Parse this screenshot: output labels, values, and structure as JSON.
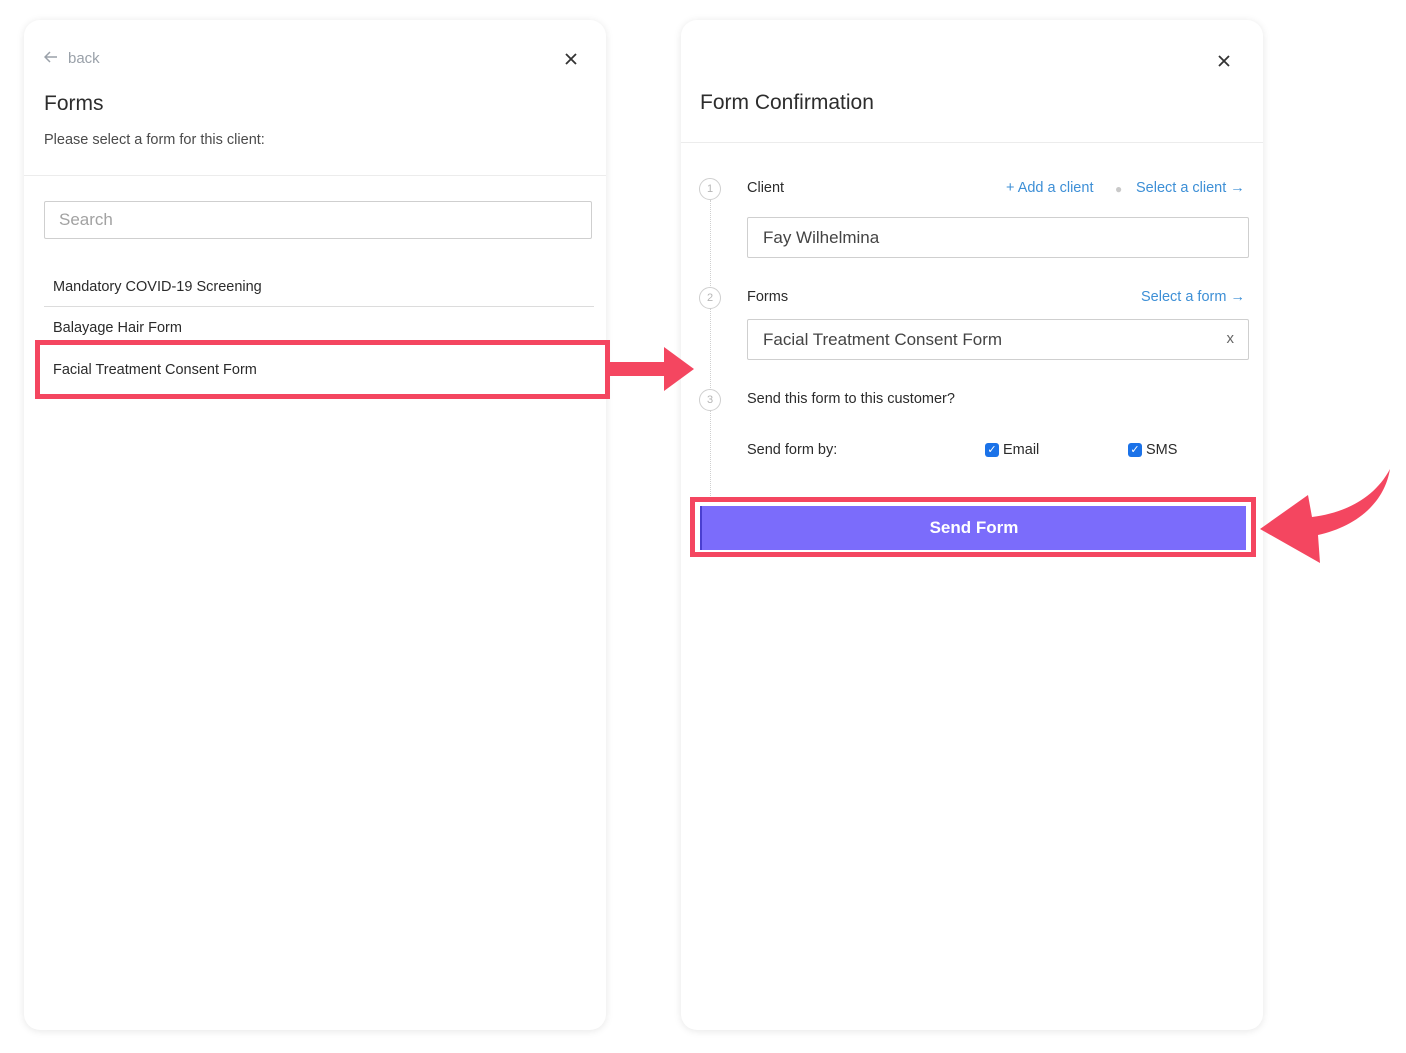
{
  "left_panel": {
    "back_label": "back",
    "close_label": "×",
    "title": "Forms",
    "subtitle": "Please select a form for this client:",
    "search_placeholder": "Search",
    "forms": [
      "Mandatory COVID-19 Screening",
      "Balayage Hair Form",
      "Facial Treatment Consent Form"
    ]
  },
  "right_panel": {
    "close_label": "×",
    "title": "Form Confirmation",
    "steps": [
      {
        "number": "1",
        "label": "Client"
      },
      {
        "number": "2",
        "label": "Forms"
      },
      {
        "number": "3",
        "label": "Send this form to this customer?"
      }
    ],
    "add_client_link": "+ Add a client",
    "select_client_link": "Select a client →",
    "select_form_link": "Select a form →",
    "client_value": "Fay Wilhelmina",
    "form_value": "Facial Treatment Consent Form",
    "clear_label": "x",
    "send_by_label": "Send form by:",
    "email_label": "Email",
    "sms_label": "SMS",
    "email_checked": true,
    "sms_checked": true,
    "send_button": "Send Form"
  },
  "colors": {
    "highlight": "#f44660",
    "accent_button": "#7b6cfb",
    "link": "#3d8fd6",
    "checkbox": "#1b72e8"
  }
}
